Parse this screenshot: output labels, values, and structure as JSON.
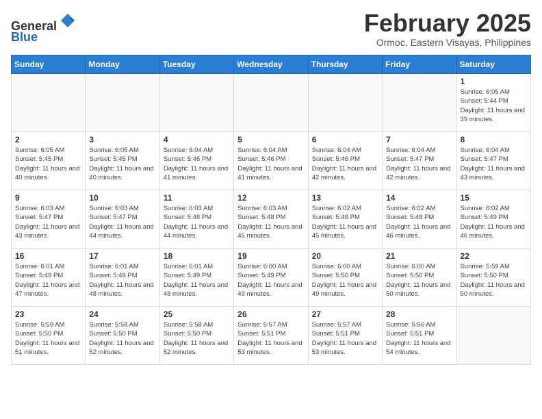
{
  "header": {
    "logo_general": "General",
    "logo_blue": "Blue",
    "month_title": "February 2025",
    "location": "Ormoc, Eastern Visayas, Philippines"
  },
  "days_of_week": [
    "Sunday",
    "Monday",
    "Tuesday",
    "Wednesday",
    "Thursday",
    "Friday",
    "Saturday"
  ],
  "weeks": [
    [
      {
        "day": "",
        "sunrise": "",
        "sunset": "",
        "daylight": ""
      },
      {
        "day": "",
        "sunrise": "",
        "sunset": "",
        "daylight": ""
      },
      {
        "day": "",
        "sunrise": "",
        "sunset": "",
        "daylight": ""
      },
      {
        "day": "",
        "sunrise": "",
        "sunset": "",
        "daylight": ""
      },
      {
        "day": "",
        "sunrise": "",
        "sunset": "",
        "daylight": ""
      },
      {
        "day": "",
        "sunrise": "",
        "sunset": "",
        "daylight": ""
      },
      {
        "day": "1",
        "sunrise": "Sunrise: 6:05 AM",
        "sunset": "Sunset: 5:44 PM",
        "daylight": "Daylight: 11 hours and 39 minutes."
      }
    ],
    [
      {
        "day": "2",
        "sunrise": "Sunrise: 6:05 AM",
        "sunset": "Sunset: 5:45 PM",
        "daylight": "Daylight: 11 hours and 40 minutes."
      },
      {
        "day": "3",
        "sunrise": "Sunrise: 6:05 AM",
        "sunset": "Sunset: 5:45 PM",
        "daylight": "Daylight: 11 hours and 40 minutes."
      },
      {
        "day": "4",
        "sunrise": "Sunrise: 6:04 AM",
        "sunset": "Sunset: 5:46 PM",
        "daylight": "Daylight: 11 hours and 41 minutes."
      },
      {
        "day": "5",
        "sunrise": "Sunrise: 6:04 AM",
        "sunset": "Sunset: 5:46 PM",
        "daylight": "Daylight: 11 hours and 41 minutes."
      },
      {
        "day": "6",
        "sunrise": "Sunrise: 6:04 AM",
        "sunset": "Sunset: 5:46 PM",
        "daylight": "Daylight: 11 hours and 42 minutes."
      },
      {
        "day": "7",
        "sunrise": "Sunrise: 6:04 AM",
        "sunset": "Sunset: 5:47 PM",
        "daylight": "Daylight: 11 hours and 42 minutes."
      },
      {
        "day": "8",
        "sunrise": "Sunrise: 6:04 AM",
        "sunset": "Sunset: 5:47 PM",
        "daylight": "Daylight: 11 hours and 43 minutes."
      }
    ],
    [
      {
        "day": "9",
        "sunrise": "Sunrise: 6:03 AM",
        "sunset": "Sunset: 5:47 PM",
        "daylight": "Daylight: 11 hours and 43 minutes."
      },
      {
        "day": "10",
        "sunrise": "Sunrise: 6:03 AM",
        "sunset": "Sunset: 5:47 PM",
        "daylight": "Daylight: 11 hours and 44 minutes."
      },
      {
        "day": "11",
        "sunrise": "Sunrise: 6:03 AM",
        "sunset": "Sunset: 5:48 PM",
        "daylight": "Daylight: 11 hours and 44 minutes."
      },
      {
        "day": "12",
        "sunrise": "Sunrise: 6:03 AM",
        "sunset": "Sunset: 5:48 PM",
        "daylight": "Daylight: 11 hours and 45 minutes."
      },
      {
        "day": "13",
        "sunrise": "Sunrise: 6:02 AM",
        "sunset": "Sunset: 5:48 PM",
        "daylight": "Daylight: 11 hours and 45 minutes."
      },
      {
        "day": "14",
        "sunrise": "Sunrise: 6:02 AM",
        "sunset": "Sunset: 5:48 PM",
        "daylight": "Daylight: 11 hours and 46 minutes."
      },
      {
        "day": "15",
        "sunrise": "Sunrise: 6:02 AM",
        "sunset": "Sunset: 5:49 PM",
        "daylight": "Daylight: 11 hours and 46 minutes."
      }
    ],
    [
      {
        "day": "16",
        "sunrise": "Sunrise: 6:01 AM",
        "sunset": "Sunset: 5:49 PM",
        "daylight": "Daylight: 11 hours and 47 minutes."
      },
      {
        "day": "17",
        "sunrise": "Sunrise: 6:01 AM",
        "sunset": "Sunset: 5:49 PM",
        "daylight": "Daylight: 11 hours and 48 minutes."
      },
      {
        "day": "18",
        "sunrise": "Sunrise: 6:01 AM",
        "sunset": "Sunset: 5:49 PM",
        "daylight": "Daylight: 11 hours and 48 minutes."
      },
      {
        "day": "19",
        "sunrise": "Sunrise: 6:00 AM",
        "sunset": "Sunset: 5:49 PM",
        "daylight": "Daylight: 11 hours and 49 minutes."
      },
      {
        "day": "20",
        "sunrise": "Sunrise: 6:00 AM",
        "sunset": "Sunset: 5:50 PM",
        "daylight": "Daylight: 11 hours and 49 minutes."
      },
      {
        "day": "21",
        "sunrise": "Sunrise: 6:00 AM",
        "sunset": "Sunset: 5:50 PM",
        "daylight": "Daylight: 11 hours and 50 minutes."
      },
      {
        "day": "22",
        "sunrise": "Sunrise: 5:59 AM",
        "sunset": "Sunset: 5:50 PM",
        "daylight": "Daylight: 11 hours and 50 minutes."
      }
    ],
    [
      {
        "day": "23",
        "sunrise": "Sunrise: 5:59 AM",
        "sunset": "Sunset: 5:50 PM",
        "daylight": "Daylight: 11 hours and 51 minutes."
      },
      {
        "day": "24",
        "sunrise": "Sunrise: 5:58 AM",
        "sunset": "Sunset: 5:50 PM",
        "daylight": "Daylight: 11 hours and 52 minutes."
      },
      {
        "day": "25",
        "sunrise": "Sunrise: 5:58 AM",
        "sunset": "Sunset: 5:50 PM",
        "daylight": "Daylight: 11 hours and 52 minutes."
      },
      {
        "day": "26",
        "sunrise": "Sunrise: 5:57 AM",
        "sunset": "Sunset: 5:51 PM",
        "daylight": "Daylight: 11 hours and 53 minutes."
      },
      {
        "day": "27",
        "sunrise": "Sunrise: 5:57 AM",
        "sunset": "Sunset: 5:51 PM",
        "daylight": "Daylight: 11 hours and 53 minutes."
      },
      {
        "day": "28",
        "sunrise": "Sunrise: 5:56 AM",
        "sunset": "Sunset: 5:51 PM",
        "daylight": "Daylight: 11 hours and 54 minutes."
      },
      {
        "day": "",
        "sunrise": "",
        "sunset": "",
        "daylight": ""
      }
    ]
  ]
}
